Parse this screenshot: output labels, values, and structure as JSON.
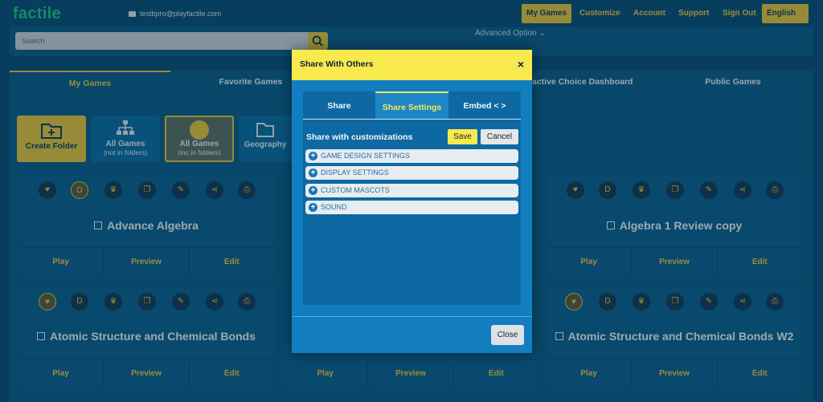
{
  "header": {
    "logo": "factile",
    "email": "testbpro@playfactile.com",
    "nav": [
      "My Games",
      "Customize",
      "Account",
      "Support",
      "Sign Out"
    ],
    "language": "English"
  },
  "search": {
    "placeholder": "Search",
    "advanced": "Advanced Option"
  },
  "tabs": [
    "My Games",
    "Favorite Games",
    "active Choice Dashboard",
    "Public Games"
  ],
  "folders": {
    "create": "Create Folder",
    "all_games": "All Games",
    "all_games_sub": "(not in folders)",
    "all_games_inc": "All Games",
    "all_games_inc_sub": "(inc in folders)",
    "geography": "Geography"
  },
  "cards": [
    {
      "title": "Advance Algebra"
    },
    {
      "title": "Algebra 1 Review copy"
    },
    {
      "title": "Atomic Structure and Chemical Bonds"
    },
    {
      "title": "Atomic Structure and Chemical Bonds W2"
    }
  ],
  "card_actions": [
    "Play",
    "Preview",
    "Edit"
  ],
  "mid_actions": [
    "Play",
    "Preview",
    "Edit"
  ],
  "modal": {
    "title": "Share With Others",
    "close_x": "×",
    "tabs": [
      "Share",
      "Share Settings",
      "Embed < >"
    ],
    "share_label": "Share with customizations",
    "save": "Save",
    "cancel": "Cancel",
    "settings": [
      "GAME DESIGN SETTINGS",
      "DISPLAY SETTINGS",
      "CUSTOM MASCOTS",
      "SOUND"
    ],
    "close": "Close"
  },
  "colors": {
    "accent": "#f0c33c",
    "modal_header": "#f8e94e",
    "modal_body": "#127ec0"
  }
}
